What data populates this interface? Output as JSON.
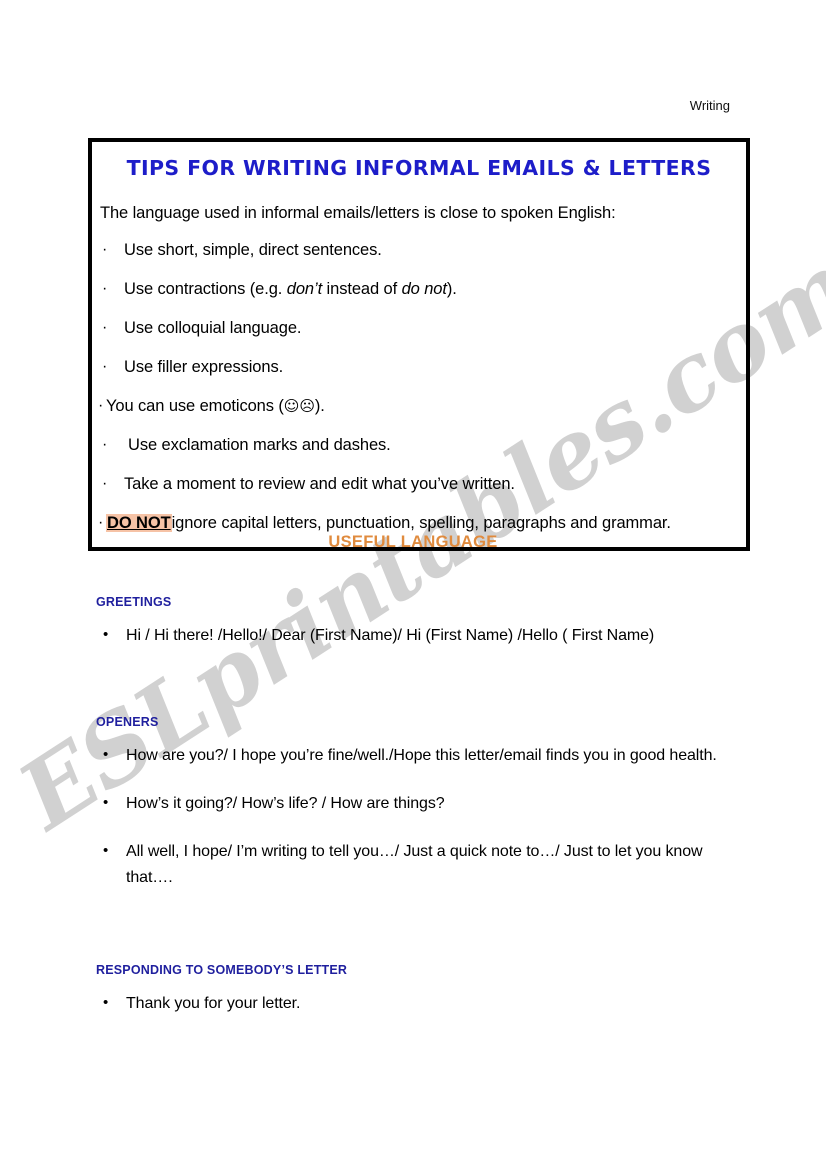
{
  "header": {
    "running_title": "Writing"
  },
  "watermark": {
    "text": "ESLprintables.com"
  },
  "tips_box": {
    "title": "TIPS FOR WRITING INFORMAL EMAILS & LETTERS",
    "intro": "The language used in informal emails/letters is close to spoken English:",
    "bullet_glyph": "·",
    "items": [
      {
        "text": "Use short, simple, direct sentences."
      },
      {
        "text_before": "Use contractions (e.g. ",
        "italic_1": "don’t",
        "text_mid": " instead of ",
        "italic_2": "do not",
        "text_after": ")."
      },
      {
        "text": "Use colloquial language."
      },
      {
        "text": "Use filler expressions."
      },
      {
        "text_before": "You can use emoticons (",
        "emoji": "☺☹",
        "text_after": ")."
      },
      {
        "text": "Use exclamation marks and dashes."
      },
      {
        "text": "Take a moment to review and edit what you’ve written."
      },
      {
        "highlight": "DO NOT",
        "text_after": "ignore capital letters, punctuation, spelling, paragraphs and grammar."
      }
    ]
  },
  "useful_language": {
    "heading": "USEFUL LANGUAGE"
  },
  "sections": [
    {
      "heading": "GREETINGS",
      "items": [
        "Hi / Hi there! /Hello!/ Dear (First Name)/ Hi (First Name) /Hello ( First Name)"
      ]
    },
    {
      "heading": "OPENERS",
      "items": [
        "How are you?/ I hope you’re fine/well./Hope this letter/email finds you in good health.",
        "How’s it going?/ How’s life? / How are things?",
        "All well, I hope/ I’m writing to tell you…/ Just a quick note to…/ Just to let you know that…."
      ]
    },
    {
      "heading": "RESPONDING TO SOMEBODY’S LETTER",
      "items": [
        "Thank you for your letter."
      ]
    }
  ],
  "colors": {
    "title_blue": "#1d1dc9",
    "heading_navy": "#1f1f9e",
    "useful_orange": "#e08b3e",
    "highlight_peach": "#f6c3a6",
    "watermark_gray": "#c9c9c9",
    "border_black": "#000000"
  },
  "bullets": {
    "round": "•",
    "middot": "·"
  }
}
